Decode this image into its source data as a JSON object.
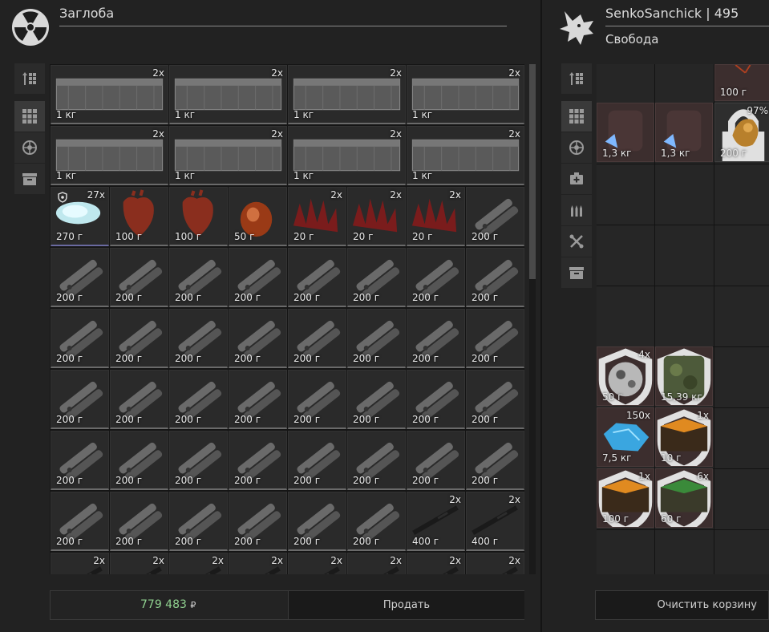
{
  "left_panel": {
    "trader_name": "Заглоба",
    "trader_icon": "radiation-icon"
  },
  "right_panel": {
    "player_name": "SenkoSanchick | 495",
    "faction": "Свобода",
    "player_icon": "wolf-head-icon"
  },
  "left_tools": [
    "sort-icon",
    "grid-icon",
    "artifact-icon",
    "container-icon"
  ],
  "right_tools": [
    "sort-icon",
    "grid-icon",
    "artifact-icon",
    "medkit-icon",
    "ammo-icon",
    "tools-icon",
    "container-icon"
  ],
  "left_grid": {
    "rows": [
      {
        "size": "wide",
        "items": [
          {
            "kind": "crate",
            "weight": "1 кг",
            "count": "2x"
          },
          {
            "kind": "crate",
            "weight": "1 кг",
            "count": "2x"
          },
          {
            "kind": "crate",
            "weight": "1 кг",
            "count": "2x"
          },
          {
            "kind": "crate",
            "weight": "1 кг",
            "count": "2x"
          }
        ]
      },
      {
        "size": "wide",
        "items": [
          {
            "kind": "crate",
            "weight": "1 кг",
            "count": "2x"
          },
          {
            "kind": "crate",
            "weight": "1 кг",
            "count": "2x"
          },
          {
            "kind": "crate",
            "weight": "1 кг",
            "count": "2x"
          },
          {
            "kind": "crate",
            "weight": "1 кг",
            "count": "2x"
          }
        ]
      },
      {
        "size": "small",
        "items": [
          {
            "kind": "crystal",
            "weight": "270 г",
            "count": "27x",
            "shield": true
          },
          {
            "kind": "heart",
            "weight": "100 г",
            "count": ""
          },
          {
            "kind": "heart",
            "weight": "100 г",
            "count": ""
          },
          {
            "kind": "gland",
            "weight": "50 г",
            "count": ""
          },
          {
            "kind": "spikes",
            "weight": "20 г",
            "count": "2x"
          },
          {
            "kind": "spikes",
            "weight": "20 г",
            "count": "2x"
          },
          {
            "kind": "spikes",
            "weight": "20 г",
            "count": "2x"
          },
          {
            "kind": "multitool",
            "weight": "200 г",
            "count": ""
          }
        ]
      },
      {
        "size": "small",
        "items": [
          {
            "kind": "multitool",
            "weight": "200 г",
            "count": ""
          },
          {
            "kind": "multitool",
            "weight": "200 г",
            "count": ""
          },
          {
            "kind": "multitool",
            "weight": "200 г",
            "count": ""
          },
          {
            "kind": "multitool",
            "weight": "200 г",
            "count": ""
          },
          {
            "kind": "multitool",
            "weight": "200 г",
            "count": ""
          },
          {
            "kind": "multitool",
            "weight": "200 г",
            "count": ""
          },
          {
            "kind": "multitool",
            "weight": "200 г",
            "count": ""
          },
          {
            "kind": "multitool",
            "weight": "200 г",
            "count": ""
          }
        ]
      },
      {
        "size": "small",
        "items": [
          {
            "kind": "multitool",
            "weight": "200 г",
            "count": ""
          },
          {
            "kind": "multitool",
            "weight": "200 г",
            "count": ""
          },
          {
            "kind": "multitool",
            "weight": "200 г",
            "count": ""
          },
          {
            "kind": "multitool",
            "weight": "200 г",
            "count": ""
          },
          {
            "kind": "multitool",
            "weight": "200 г",
            "count": ""
          },
          {
            "kind": "multitool",
            "weight": "200 г",
            "count": ""
          },
          {
            "kind": "multitool",
            "weight": "200 г",
            "count": ""
          },
          {
            "kind": "multitool",
            "weight": "200 г",
            "count": ""
          }
        ]
      },
      {
        "size": "small",
        "items": [
          {
            "kind": "multitool",
            "weight": "200 г",
            "count": ""
          },
          {
            "kind": "multitool",
            "weight": "200 г",
            "count": ""
          },
          {
            "kind": "multitool",
            "weight": "200 г",
            "count": ""
          },
          {
            "kind": "multitool",
            "weight": "200 г",
            "count": ""
          },
          {
            "kind": "multitool",
            "weight": "200 г",
            "count": ""
          },
          {
            "kind": "multitool",
            "weight": "200 г",
            "count": ""
          },
          {
            "kind": "multitool",
            "weight": "200 г",
            "count": ""
          },
          {
            "kind": "multitool",
            "weight": "200 г",
            "count": ""
          }
        ]
      },
      {
        "size": "small",
        "items": [
          {
            "kind": "multitool",
            "weight": "200 г",
            "count": ""
          },
          {
            "kind": "multitool",
            "weight": "200 г",
            "count": ""
          },
          {
            "kind": "multitool",
            "weight": "200 г",
            "count": ""
          },
          {
            "kind": "multitool",
            "weight": "200 г",
            "count": ""
          },
          {
            "kind": "multitool",
            "weight": "200 г",
            "count": ""
          },
          {
            "kind": "multitool",
            "weight": "200 г",
            "count": ""
          },
          {
            "kind": "multitool",
            "weight": "200 г",
            "count": ""
          },
          {
            "kind": "multitool",
            "weight": "200 г",
            "count": ""
          }
        ]
      },
      {
        "size": "small",
        "items": [
          {
            "kind": "multitool",
            "weight": "200 г",
            "count": ""
          },
          {
            "kind": "multitool",
            "weight": "200 г",
            "count": ""
          },
          {
            "kind": "multitool",
            "weight": "200 г",
            "count": ""
          },
          {
            "kind": "multitool",
            "weight": "200 г",
            "count": ""
          },
          {
            "kind": "multitool",
            "weight": "200 г",
            "count": ""
          },
          {
            "kind": "multitool",
            "weight": "200 г",
            "count": ""
          },
          {
            "kind": "blade",
            "weight": "400 г",
            "count": "2x"
          },
          {
            "kind": "blade",
            "weight": "400 г",
            "count": "2x"
          }
        ]
      },
      {
        "size": "small",
        "items": [
          {
            "kind": "blade",
            "weight": "",
            "count": "2x"
          },
          {
            "kind": "blade",
            "weight": "",
            "count": "2x"
          },
          {
            "kind": "blade",
            "weight": "",
            "count": "2x"
          },
          {
            "kind": "blade",
            "weight": "",
            "count": "2x"
          },
          {
            "kind": "blade",
            "weight": "",
            "count": "2x"
          },
          {
            "kind": "blade",
            "weight": "",
            "count": "2x"
          },
          {
            "kind": "blade",
            "weight": "",
            "count": "2x"
          },
          {
            "kind": "blade",
            "weight": "",
            "count": "2x"
          }
        ]
      }
    ]
  },
  "right_grid": {
    "items": [
      {
        "kind": "drone",
        "weight": "100 г",
        "count": "",
        "col": 2,
        "row": 0,
        "partial_top": true
      },
      {
        "kind": "backpack",
        "weight": "1,3 кг",
        "count": "",
        "col": 0,
        "row": 1
      },
      {
        "kind": "backpack",
        "weight": "1,3 кг",
        "count": "",
        "col": 1,
        "row": 1
      },
      {
        "kind": "artifact-gold",
        "weight": "200 г",
        "count": "97%",
        "col": 2,
        "row": 1,
        "lock": true
      },
      {
        "kind": "mech-part",
        "weight": "50 г",
        "count": "4x",
        "col": 0,
        "row": 5,
        "shield": true
      },
      {
        "kind": "camo-armor",
        "weight": "15,39 кг",
        "count": "",
        "col": 1,
        "row": 5,
        "shield": true
      },
      {
        "kind": "blue-crystal",
        "weight": "7,5 кг",
        "count": "150x",
        "col": 0,
        "row": 6
      },
      {
        "kind": "orange-box",
        "weight": "10 г",
        "count": "1x",
        "col": 1,
        "row": 6,
        "shield": true
      },
      {
        "kind": "orange-box",
        "weight": "100 г",
        "count": "1x",
        "col": 0,
        "row": 7,
        "shield": true
      },
      {
        "kind": "green-box",
        "weight": "60 г",
        "count": "6x",
        "col": 1,
        "row": 7,
        "shield": true
      }
    ]
  },
  "footer": {
    "money": "779 483",
    "currency": "₽",
    "sell_label": "Продать",
    "clear_label": "Очистить корзину"
  },
  "colors": {
    "money": "#8fd08f",
    "selected_cell": "#3c2e2e"
  }
}
